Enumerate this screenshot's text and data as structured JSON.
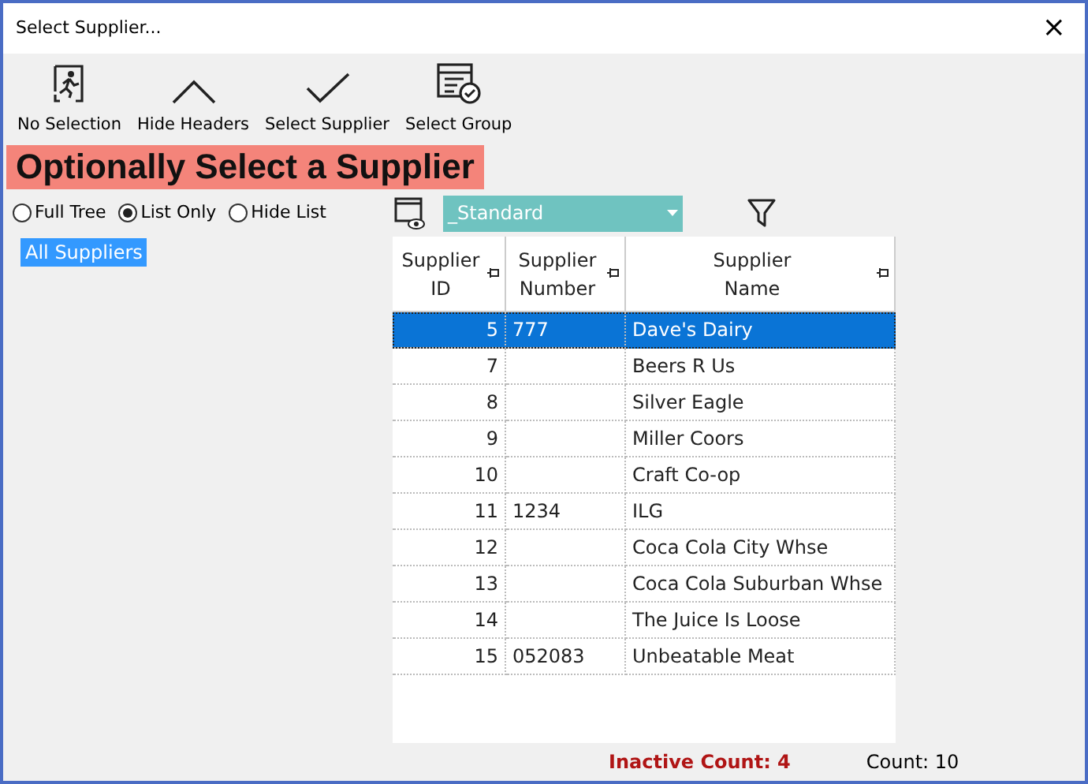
{
  "window": {
    "title": "Select Supplier...",
    "close": "×"
  },
  "toolbar": [
    {
      "kind": "runner",
      "label": "No Selection"
    },
    {
      "kind": "caret",
      "label": "Hide Headers"
    },
    {
      "kind": "check",
      "label": "Select Supplier"
    },
    {
      "kind": "group",
      "label": "Select Group"
    }
  ],
  "banner": "Optionally Select a Supplier",
  "view_options": [
    {
      "label": "Full Tree",
      "selected": false
    },
    {
      "label": "List Only",
      "selected": true
    },
    {
      "label": "Hide List",
      "selected": false
    }
  ],
  "layout_select": {
    "value": "_Standard"
  },
  "tree": [
    {
      "label": "All Suppliers",
      "selected": true
    }
  ],
  "table": {
    "columns": [
      "Supplier\nID",
      "Supplier\nNumber",
      "Supplier\nName"
    ],
    "rows": [
      {
        "cells": [
          "5",
          "777",
          "Dave's Dairy"
        ],
        "selected": true
      },
      {
        "cells": [
          "7",
          "",
          "Beers R Us"
        ],
        "selected": false
      },
      {
        "cells": [
          "8",
          "",
          "Silver Eagle"
        ],
        "selected": false
      },
      {
        "cells": [
          "9",
          "",
          "Miller Coors"
        ],
        "selected": false
      },
      {
        "cells": [
          "10",
          "",
          "Craft Co-op"
        ],
        "selected": false
      },
      {
        "cells": [
          "11",
          "1234",
          "ILG"
        ],
        "selected": false
      },
      {
        "cells": [
          "12",
          "",
          "Coca Cola City Whse"
        ],
        "selected": false
      },
      {
        "cells": [
          "13",
          "",
          "Coca Cola Suburban Whse"
        ],
        "selected": false
      },
      {
        "cells": [
          "14",
          "",
          "The Juice Is Loose"
        ],
        "selected": false
      },
      {
        "cells": [
          "15",
          "052083",
          "Unbeatable Meat"
        ],
        "selected": false
      }
    ]
  },
  "status_bar": {
    "inactive_count": "Inactive Count: 4",
    "count": "Count: 10"
  }
}
